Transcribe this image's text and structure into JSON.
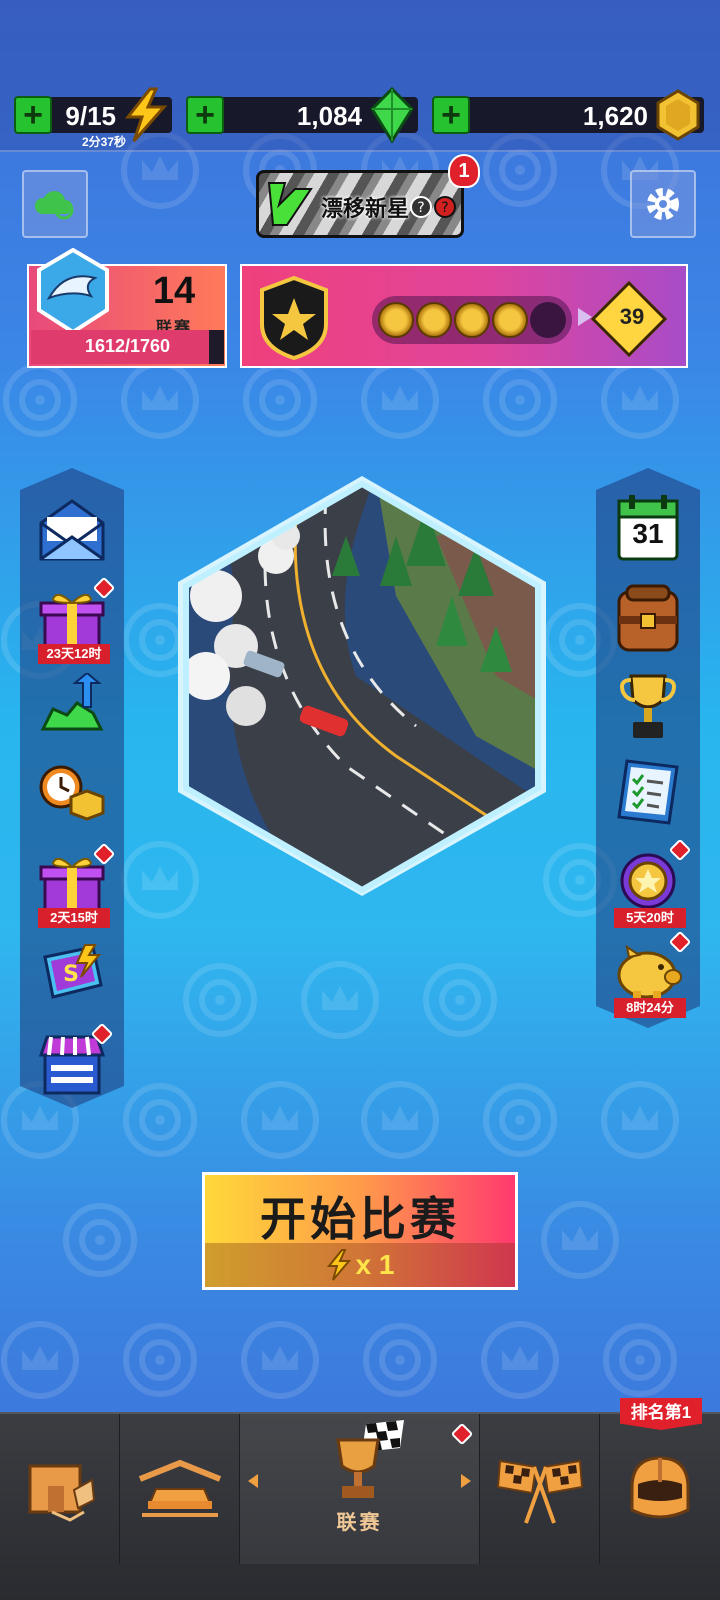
{
  "resources": {
    "energy": {
      "value": "9/15",
      "timer": "2分37秒"
    },
    "gems": {
      "value": "1,084"
    },
    "coins": {
      "value": "1,620"
    }
  },
  "banner": {
    "title": "漂移新星",
    "notification_count": "1"
  },
  "league": {
    "number": "14",
    "label": "联赛",
    "progress_text": "1612/1760",
    "progress_fraction": 0.916
  },
  "stars": {
    "filled": 4,
    "total": 5,
    "level": "39"
  },
  "left_rail": {
    "gift1_timer": "23天12时",
    "gift2_timer": "2天15时"
  },
  "right_rail": {
    "calendar_day": "31",
    "medal_timer": "5天20时",
    "piggy_timer": "8时24分"
  },
  "start": {
    "label": "开始比赛",
    "cost": "x 1"
  },
  "nav": {
    "league_label": "联赛",
    "rank_label": "排名第1"
  },
  "colors": {
    "accent": "#ff3a6e",
    "plus_green": "#27c22f",
    "alert_red": "#e0202a"
  }
}
